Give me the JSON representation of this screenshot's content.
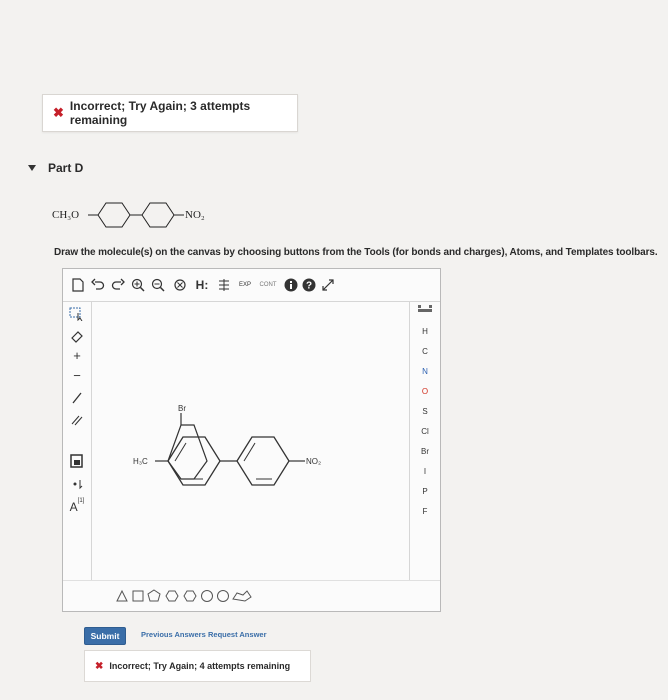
{
  "feedback_top": {
    "icon": "✖",
    "text": "Incorrect; Try Again; 3 attempts remaining"
  },
  "part": {
    "label": "Part D"
  },
  "question_molecule": {
    "left_group": "CH₃O",
    "right_group": "NO₂"
  },
  "instructions": "Draw the molecule(s) on the canvas by choosing buttons from the Tools (for bonds and charges), Atoms, and Templates toolbars.",
  "toolbar_top": {
    "h_label": "H:",
    "exp_label": "EXP",
    "cont_label": "CONT"
  },
  "toolbar_left": {
    "plus": "+",
    "minus": "−",
    "charge_label": "A",
    "charge_sup": "[1]"
  },
  "atoms": [
    "H",
    "C",
    "N",
    "O",
    "S",
    "Cl",
    "Br",
    "I",
    "P",
    "F"
  ],
  "canvas_molecule": {
    "top_sub": "Br",
    "left_group": "H₃C",
    "right_group": "NO₂"
  },
  "submit": {
    "label": "Submit"
  },
  "links": {
    "previous": "Previous Answers",
    "request": "Request Answer"
  },
  "feedback_bottom": {
    "icon": "✖",
    "text": "Incorrect; Try Again; 4 attempts remaining"
  },
  "colors": {
    "error": "#c5202a",
    "link": "#3a6ea8",
    "submit": "#3a6ea8",
    "atom_O": "#d03020",
    "atom_N": "#2a5fb0"
  }
}
